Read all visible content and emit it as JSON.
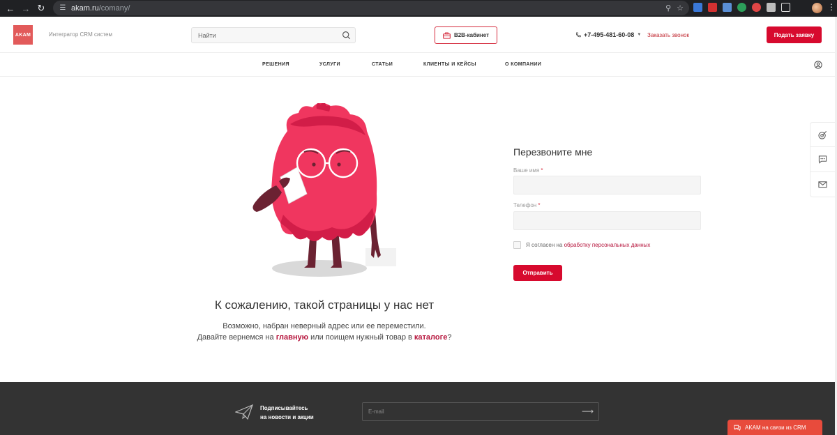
{
  "browser": {
    "url_host": "akam.ru",
    "url_path": "/comany/"
  },
  "header": {
    "logo_text": "AKAM",
    "tagline": "Интегратор CRM систем",
    "search_placeholder": "Найти",
    "b2b_label": "B2B-кабинет",
    "phone": "+7-495-481-60-08",
    "callback_label": "Заказать звонок",
    "apply_label": "Подать заявку",
    "accent_color": "#d70a2e"
  },
  "nav": {
    "items": [
      {
        "label": "РЕШЕНИЯ"
      },
      {
        "label": "УСЛУГИ"
      },
      {
        "label": "СТАТЬИ"
      },
      {
        "label": "КЛИЕНТЫ И КЕЙСЫ"
      },
      {
        "label": "О КОМПАНИИ"
      }
    ]
  },
  "error": {
    "title": "К сожалению, такой страницы у нас нет",
    "line1": "Возможно, набран неверный адрес или ее переместили.",
    "line2_start": "Давайте вернемся на ",
    "main_link": "главную",
    "line2_mid": " или поищем нужный товар в ",
    "catalog_link": "каталоге",
    "line2_end": "?"
  },
  "form": {
    "title": "Перезвоните мне",
    "name_label": "Ваше имя",
    "phone_label": "Телефон",
    "required_mark": "*",
    "consent_text": "Я согласен на ",
    "consent_link": "обработку персональных данных",
    "submit_label": "Отправить"
  },
  "footer": {
    "subscribe_line1": "Подписывайтесь",
    "subscribe_line2": "на новости и акции",
    "email_placeholder": "E-mail",
    "arrow": "⟶"
  },
  "chat": {
    "label": "AKAM на связи из CRM"
  }
}
